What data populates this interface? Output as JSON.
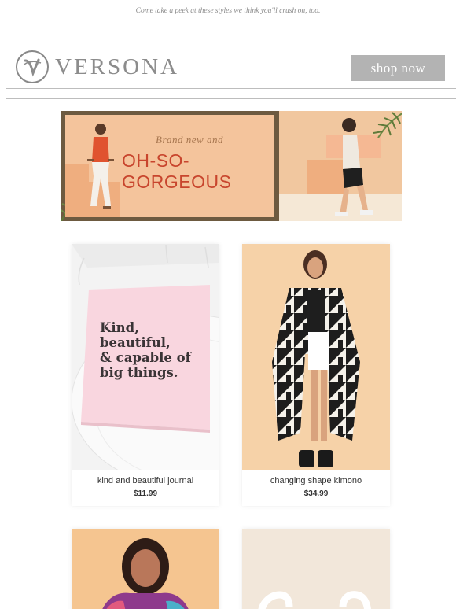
{
  "preheader": "Come take a peek at these styles we think you'll crush on, too.",
  "header": {
    "brand": "VERSONA",
    "logo_letter": "V",
    "shop_now_label": "shop now"
  },
  "banner": {
    "script_text": "Brand new and",
    "headline": "OH-SO-GORGEOUS"
  },
  "products": [
    {
      "name": "kind and beautiful journal",
      "price": "$11.99",
      "journal_text": [
        "Kind,",
        "beautiful,",
        "& capable of",
        "big things."
      ]
    },
    {
      "name": "changing shape kimono",
      "price": "$34.99"
    }
  ],
  "colors": {
    "accent_button": "#b3b3b3",
    "banner_peach": "#f4c49c",
    "headline_orange": "#c8452d"
  }
}
